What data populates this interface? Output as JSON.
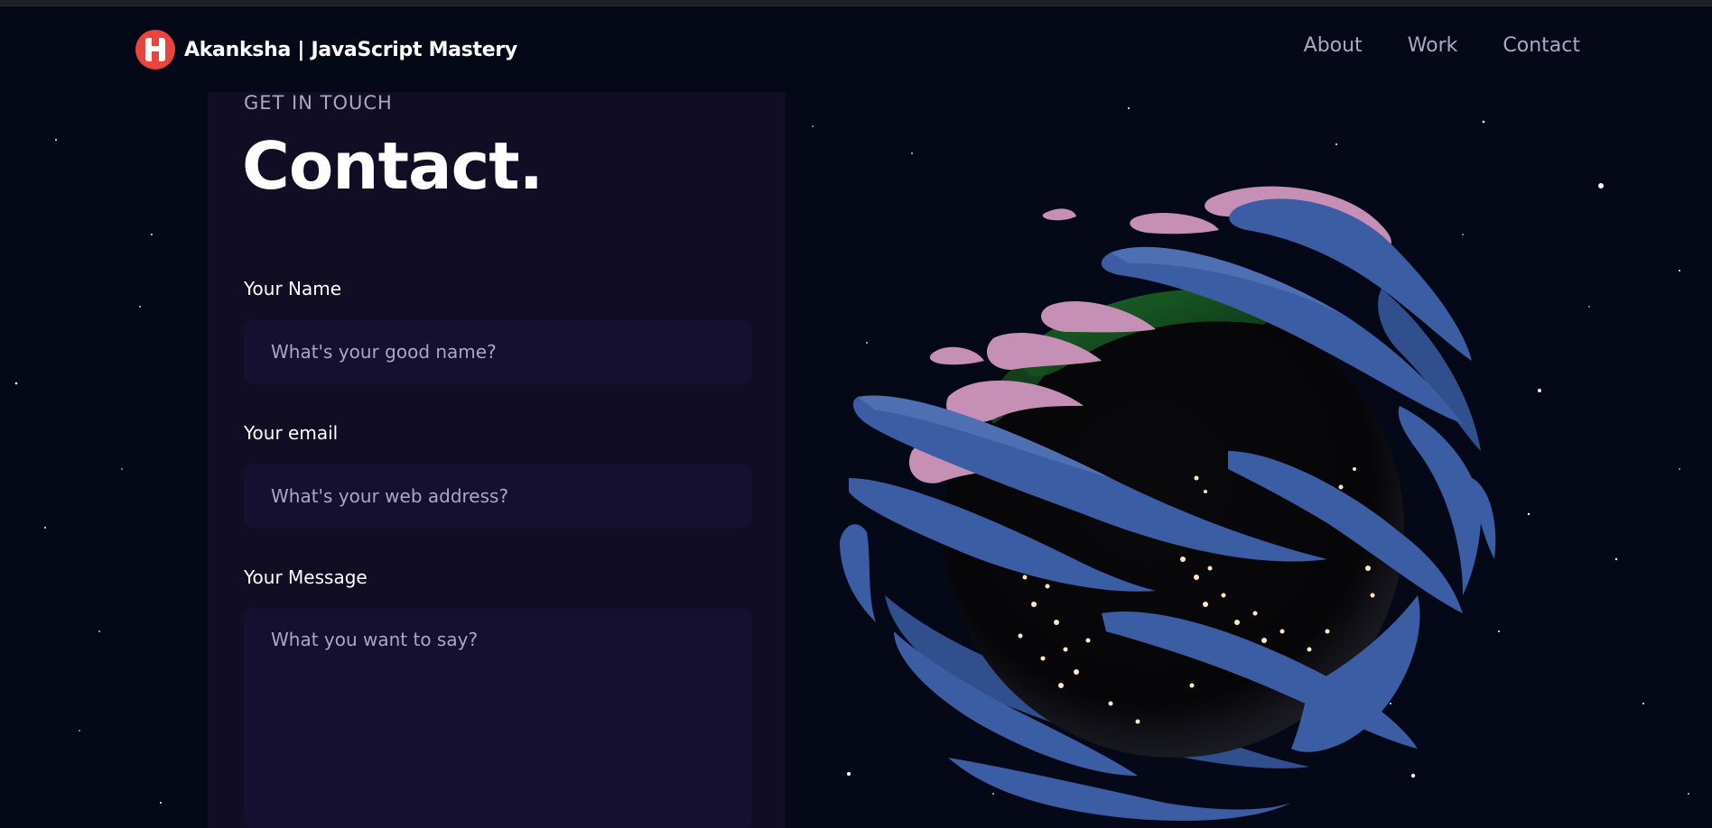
{
  "navbar": {
    "brand_name": "Akanksha | JavaScript Mastery",
    "logo_icon": "brand-logo-icon",
    "links": [
      "About",
      "Work",
      "Contact"
    ]
  },
  "contact": {
    "eyebrow": "GET IN TOUCH",
    "heading": "Contact.",
    "name_label": "Your Name",
    "name_placeholder": "What's your good name?",
    "email_label": "Your email",
    "email_placeholder": "What's your web address?",
    "message_label": "Your Message",
    "message_placeholder": "What you want to say?"
  },
  "colors": {
    "background": "#050816",
    "card": "#100d25",
    "input": "#151030",
    "secondary_text": "#aaa6c3",
    "logo": "#e8453c"
  },
  "scene": {
    "object": "earth-globe-with-blue-pink-ribbons"
  }
}
